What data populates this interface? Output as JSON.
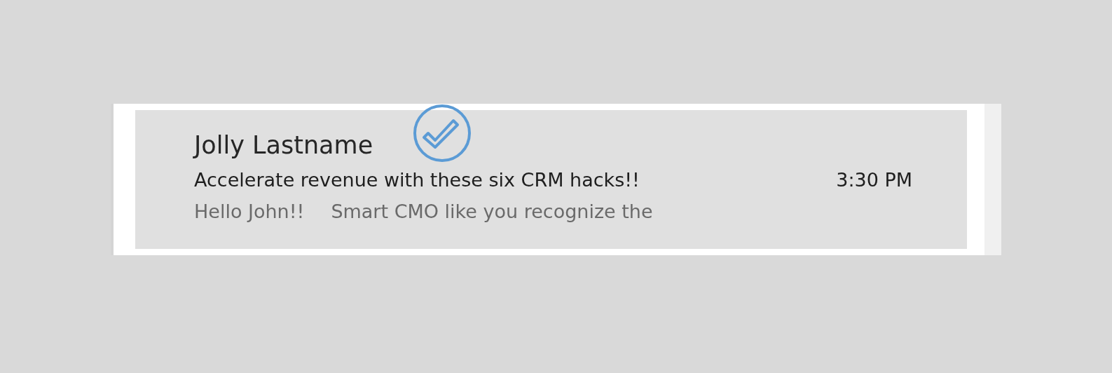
{
  "message": {
    "sender": "Jolly Lastname",
    "read": true,
    "subject": "Accelerate revenue with these six CRM hacks!!",
    "time": "3:30 PM",
    "preview": [
      "Hello John!!",
      "Smart CMO like you recognize the"
    ],
    "selected": true
  }
}
